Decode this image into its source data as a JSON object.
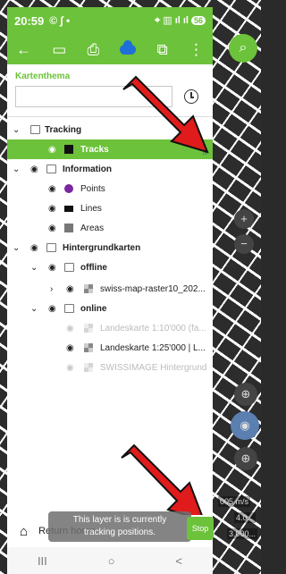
{
  "status_bar": {
    "time": "20:59",
    "icons": "© ∫ •",
    "right": "⌖ ▥ ıl ıl",
    "battery": "56"
  },
  "toolbar": {
    "back": "←",
    "ruler": "▭",
    "print": "⎙",
    "folder": "⧉",
    "menu": "⋮"
  },
  "search_fab": "⌕",
  "kartenthema": {
    "label": "Kartenthema",
    "value": ""
  },
  "layers": {
    "tracking": {
      "label": "Tracking"
    },
    "tracks": {
      "label": "Tracks"
    },
    "information": {
      "label": "Information"
    },
    "points": {
      "label": "Points"
    },
    "lines": {
      "label": "Lines"
    },
    "areas": {
      "label": "Areas"
    },
    "hintergrundkarten": {
      "label": "Hintergrundkarten"
    },
    "offline": {
      "label": "offline"
    },
    "swiss_raster": {
      "label": "swiss-map-raster10_202..."
    },
    "online": {
      "label": "online"
    },
    "lk10": {
      "label": "Landeskarte 1:10'000 (fa..."
    },
    "lk25": {
      "label": "Landeskarte 1:25'000 | L..."
    },
    "swissimage": {
      "label": "SWISSIMAGE Hintergrund"
    }
  },
  "map": {
    "zoom_in": "+",
    "zoom_out": "−",
    "scale_1": "005 m/s",
    "scale_2": "4.0...",
    "scale_3": "3.000..."
  },
  "bottom": {
    "home_icon": "⌂",
    "return_label": "Return home"
  },
  "toast": {
    "line1": "This layer is is currently",
    "line2": "tracking positions.",
    "stop": "Stop"
  },
  "navbar": {
    "recent": "III",
    "home": "○",
    "back": "<"
  },
  "colors": {
    "accent": "#6cc23a",
    "arrow": "#e01b1b",
    "points": "#7b27a0"
  }
}
